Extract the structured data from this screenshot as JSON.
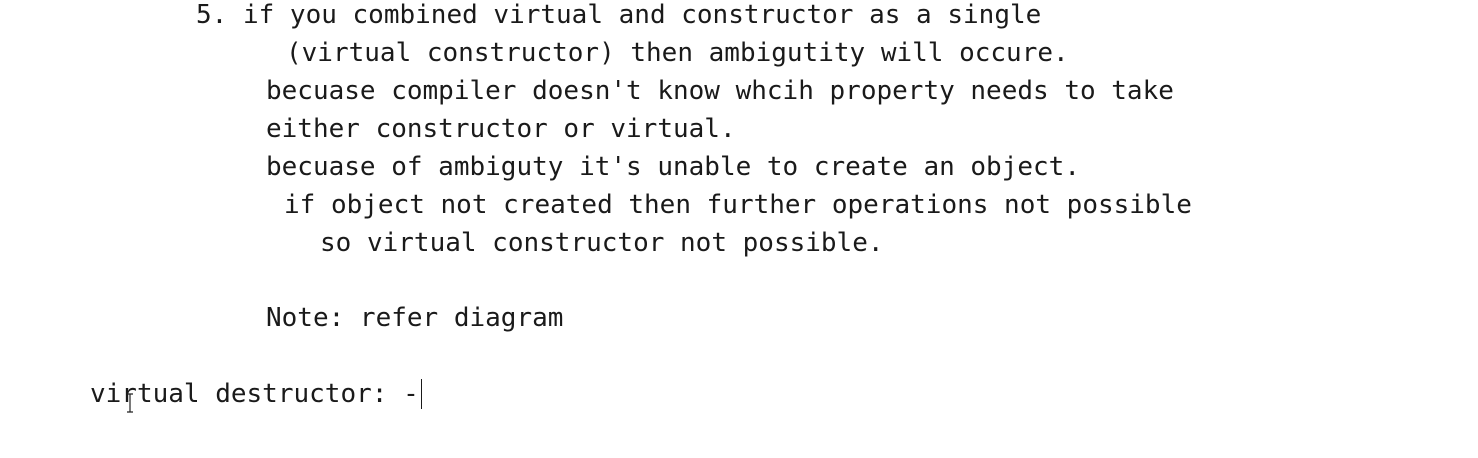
{
  "document": {
    "lines": [
      "5. if you combined virtual and constructor as a single",
      "(virtual constructor) then ambigutity will occure.",
      "becuase compiler doesn't know whcih property needs to take",
      "either constructor or virtual.",
      "becuase of ambiguty it's unable to create an object.",
      "if object not created then further operations not possible",
      "so virtual constructor not possible.",
      "Note: refer diagram",
      "virtual destructor: -"
    ]
  },
  "icons": {
    "mouse_cursor": "text-ibeam-cursor-icon"
  }
}
